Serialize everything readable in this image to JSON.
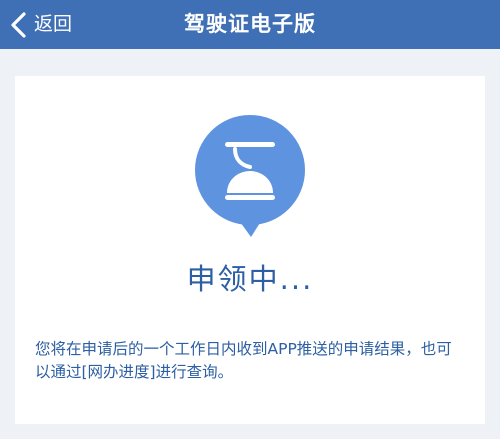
{
  "colors": {
    "nav_background": "#3f6fb4",
    "page_background": "#eef1f6",
    "card_background": "#ffffff",
    "accent": "#5e93e0",
    "text_blue": "#2c5fa3"
  },
  "header": {
    "back_label": "返回",
    "title": "驾驶证电子版"
  },
  "status": {
    "icon": "hourglass-bubble-icon",
    "title": "申领中...",
    "description": "您将在申请后的一个工作日内收到APP推送的申请结果，也可以通过[网办进度]进行查询。"
  }
}
